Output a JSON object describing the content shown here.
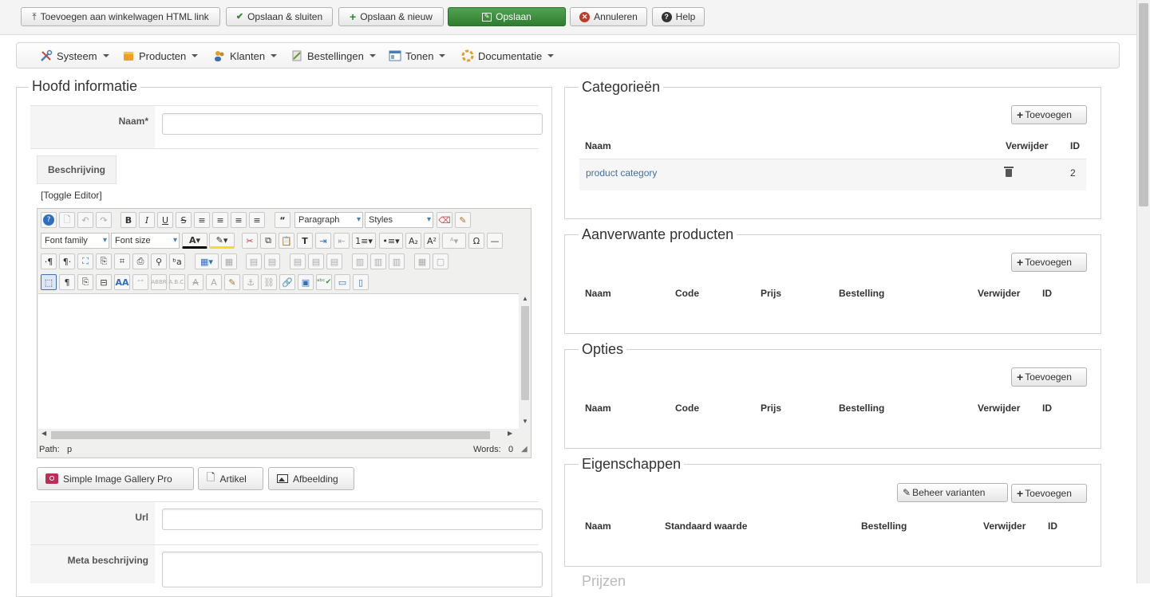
{
  "toolbar": {
    "add_to_cart_link": "Toevoegen aan winkelwagen HTML link",
    "save_close": "Opslaan & sluiten",
    "save_new": "Opslaan & nieuw",
    "save": "Opslaan",
    "cancel": "Annuleren",
    "help": "Help"
  },
  "menu": {
    "items": [
      "Systeem",
      "Producten",
      "Klanten",
      "Bestellingen",
      "Tonen",
      "Documentatie"
    ]
  },
  "main_info": {
    "legend": "Hoofd informatie",
    "name_label": "Naam*",
    "name_value": "",
    "description_tab": "Beschrijving",
    "toggle_editor": "[Toggle Editor]",
    "url_label": "Url",
    "url_value": "",
    "meta_label": "Meta beschrijving",
    "meta_value": ""
  },
  "editor": {
    "format_select": "Paragraph",
    "styles_select": "Styles",
    "font_family_select": "Font family",
    "font_size_select": "Font size",
    "path_label": "Path:",
    "path_value": "p",
    "words_label": "Words:",
    "words_value": "0",
    "buttons": {
      "gallery": "Simple Image Gallery Pro",
      "article": "Artikel",
      "image": "Afbeelding"
    }
  },
  "categories": {
    "legend": "Categorieën",
    "add": "Toevoegen",
    "headers": [
      "Naam",
      "Verwijder",
      "ID"
    ],
    "rows": [
      {
        "name": "product category",
        "id": "2"
      }
    ]
  },
  "related": {
    "legend": "Aanverwante producten",
    "add": "Toevoegen",
    "headers": [
      "Naam",
      "Code",
      "Prijs",
      "Bestelling",
      "Verwijder",
      "ID"
    ]
  },
  "options": {
    "legend": "Opties",
    "add": "Toevoegen",
    "headers": [
      "Naam",
      "Code",
      "Prijs",
      "Bestelling",
      "Verwijder",
      "ID"
    ]
  },
  "properties": {
    "legend": "Eigenschappen",
    "manage_variants": "Beheer varianten",
    "add": "Toevoegen",
    "headers": [
      "Naam",
      "Standaard waarde",
      "Bestelling",
      "Verwijder",
      "ID"
    ]
  },
  "prices": {
    "legend": "Prijzen"
  },
  "colors": {
    "save_green": "#3d923d",
    "link_blue": "#3f6fa8",
    "cancel_red": "#c0392b"
  }
}
